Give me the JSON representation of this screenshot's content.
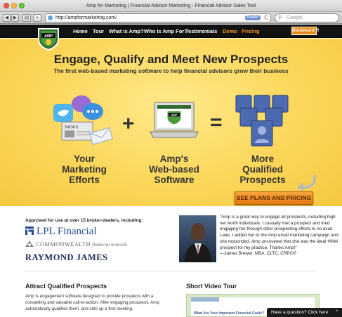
{
  "window": {
    "title": "Amp for Marketing | Financial Advisor Marketing - Financial Advisor Sales Tool"
  },
  "toolbar": {
    "back": "◀",
    "forward": "▶",
    "reader": "▤",
    "add": "+",
    "url": "http://ampformarketing.com/",
    "rss_badge": "Reader",
    "reload": "C",
    "search_placeholder": "Google"
  },
  "nav": {
    "items": [
      {
        "label": "Home"
      },
      {
        "label": "Tour"
      },
      {
        "label": "What is Amp?"
      },
      {
        "label": "Who Is Amp For?"
      },
      {
        "label": "Testimonials"
      },
      {
        "label": "Demo"
      },
      {
        "label": "Pricing"
      }
    ],
    "button": "Boulevard R",
    "logo_text": "AMP",
    "colors": {
      "accent": "#f7931e",
      "bar": "#111111"
    }
  },
  "hero": {
    "title": "Engage, Qualify and Meet New Prospects",
    "subtitle": "The first web-based marketing software to help financial advisors grow their business",
    "news_label": "NEWS",
    "laptop_logo": "AMP",
    "plus": "+",
    "equals": "=",
    "captions": [
      {
        "lines": [
          "Your",
          "Marketing",
          "Efforts"
        ]
      },
      {
        "lines": [
          "Amp's",
          "Web-based",
          "Software"
        ]
      },
      {
        "lines": [
          "More",
          "Qualified",
          "Prospects"
        ]
      }
    ],
    "cta": "SEE PLANS AND PRICING",
    "colors": {
      "background": "#fbd75a",
      "cta": "#f39a2a"
    }
  },
  "brokers": {
    "heading": "Approved for use at over 15 broker-dealers, including:",
    "lpl": "LPL Financial",
    "commonwealth": "COMMONWEALTH",
    "commonwealth_suffix": "financial network",
    "raymond": "RAYMOND JAMES"
  },
  "testimonial": {
    "quote": "\"Amp is a great way to engage all prospects, including high net worth individuals. I casually met a prospect and tried engaging her through other prospecting efforts to no avail. Later, I added her to the Amp email marketing campaign and she responded. Amp uncovered that she was the ideal HNW prospect for my practice. Thanks Amp!\"",
    "attribution": "—James Brewer, MBA, CLTC, CRPC®"
  },
  "attract": {
    "heading": "Attract Qualified Prospects",
    "body": "Amp is engagement software designed to provide prospects with a compelling and valuable call-to-action. After engaging prospects, Amp automatically qualifies them, and sets up a first meeting."
  },
  "video": {
    "heading": "Short Video Tour",
    "thumb_text": "What Are Your Important Financial Goals?"
  },
  "chat": {
    "label": "Have a question? Click here",
    "caret": "^"
  }
}
